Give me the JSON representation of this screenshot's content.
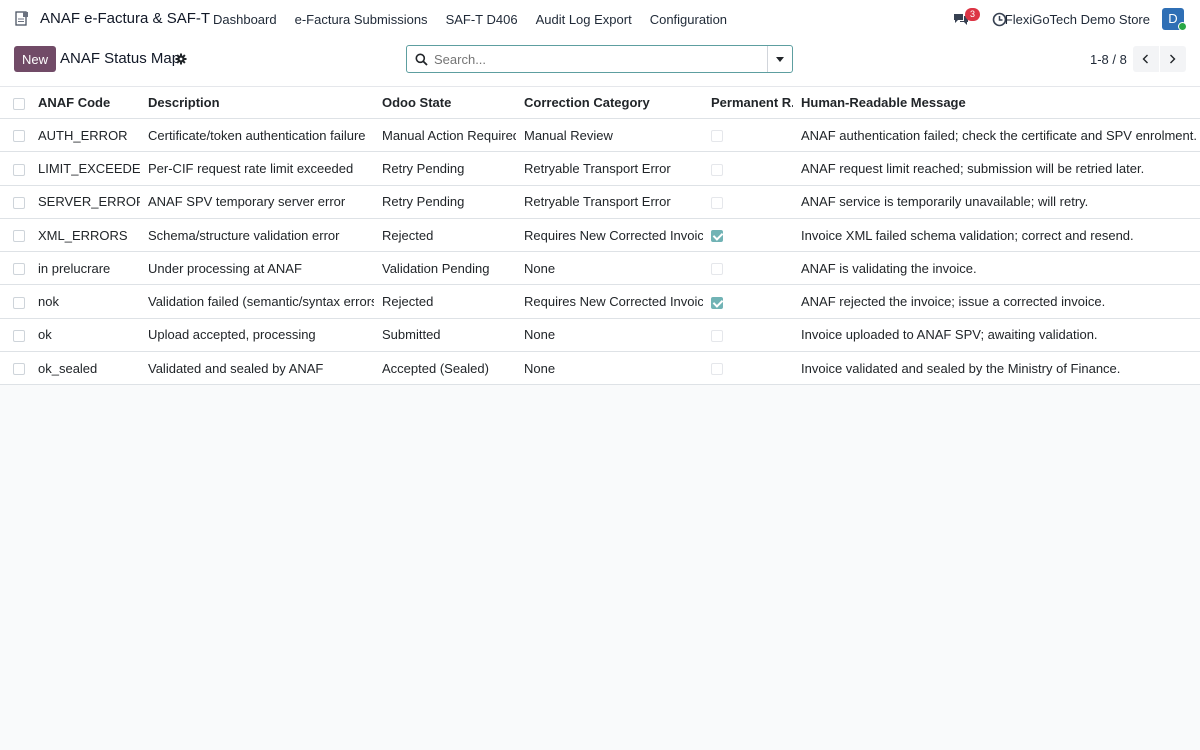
{
  "navbar": {
    "app_title": "ANAF e-Factura & SAF-T",
    "menu": [
      "Dashboard",
      "e-Factura Submissions",
      "SAF-T D406",
      "Audit Log Export",
      "Configuration"
    ],
    "messages_count": "3",
    "company": "FlexiGoTech Demo Store",
    "avatar_initial": "D"
  },
  "control": {
    "new_label": "New",
    "title": "ANAF Status Map",
    "search_placeholder": "Search...",
    "pager": "1-8 / 8"
  },
  "table": {
    "headers": {
      "code": "ANAF Code",
      "description": "Description",
      "state": "Odoo State",
      "category": "Correction Category",
      "permanent": "Permanent R...",
      "message": "Human-Readable Message"
    },
    "rows": [
      {
        "code": "AUTH_ERROR",
        "description": "Certificate/token authentication failure",
        "state": "Manual Action Required",
        "category": "Manual Review",
        "permanent": false,
        "message": "ANAF authentication failed; check the certificate and SPV enrolment."
      },
      {
        "code": "LIMIT_EXCEEDED",
        "description": "Per-CIF request rate limit exceeded",
        "state": "Retry Pending",
        "category": "Retryable Transport Error",
        "permanent": false,
        "message": "ANAF request limit reached; submission will be retried later."
      },
      {
        "code": "SERVER_ERROR",
        "description": "ANAF SPV temporary server error",
        "state": "Retry Pending",
        "category": "Retryable Transport Error",
        "permanent": false,
        "message": "ANAF service is temporarily unavailable; will retry."
      },
      {
        "code": "XML_ERRORS",
        "description": "Schema/structure validation error",
        "state": "Rejected",
        "category": "Requires New Corrected Invoice",
        "permanent": true,
        "message": "Invoice XML failed schema validation; correct and resend."
      },
      {
        "code": "in prelucrare",
        "description": "Under processing at ANAF",
        "state": "Validation Pending",
        "category": "None",
        "permanent": false,
        "message": "ANAF is validating the invoice."
      },
      {
        "code": "nok",
        "description": "Validation failed (semantic/syntax errors)",
        "state": "Rejected",
        "category": "Requires New Corrected Invoice",
        "permanent": true,
        "message": "ANAF rejected the invoice; issue a corrected invoice."
      },
      {
        "code": "ok",
        "description": "Upload accepted, processing",
        "state": "Submitted",
        "category": "None",
        "permanent": false,
        "message": "Invoice uploaded to ANAF SPV; awaiting validation."
      },
      {
        "code": "ok_sealed",
        "description": "Validated and sealed by ANAF",
        "state": "Accepted (Sealed)",
        "category": "None",
        "permanent": false,
        "message": "Invoice validated and sealed by the Ministry of Finance."
      }
    ]
  }
}
